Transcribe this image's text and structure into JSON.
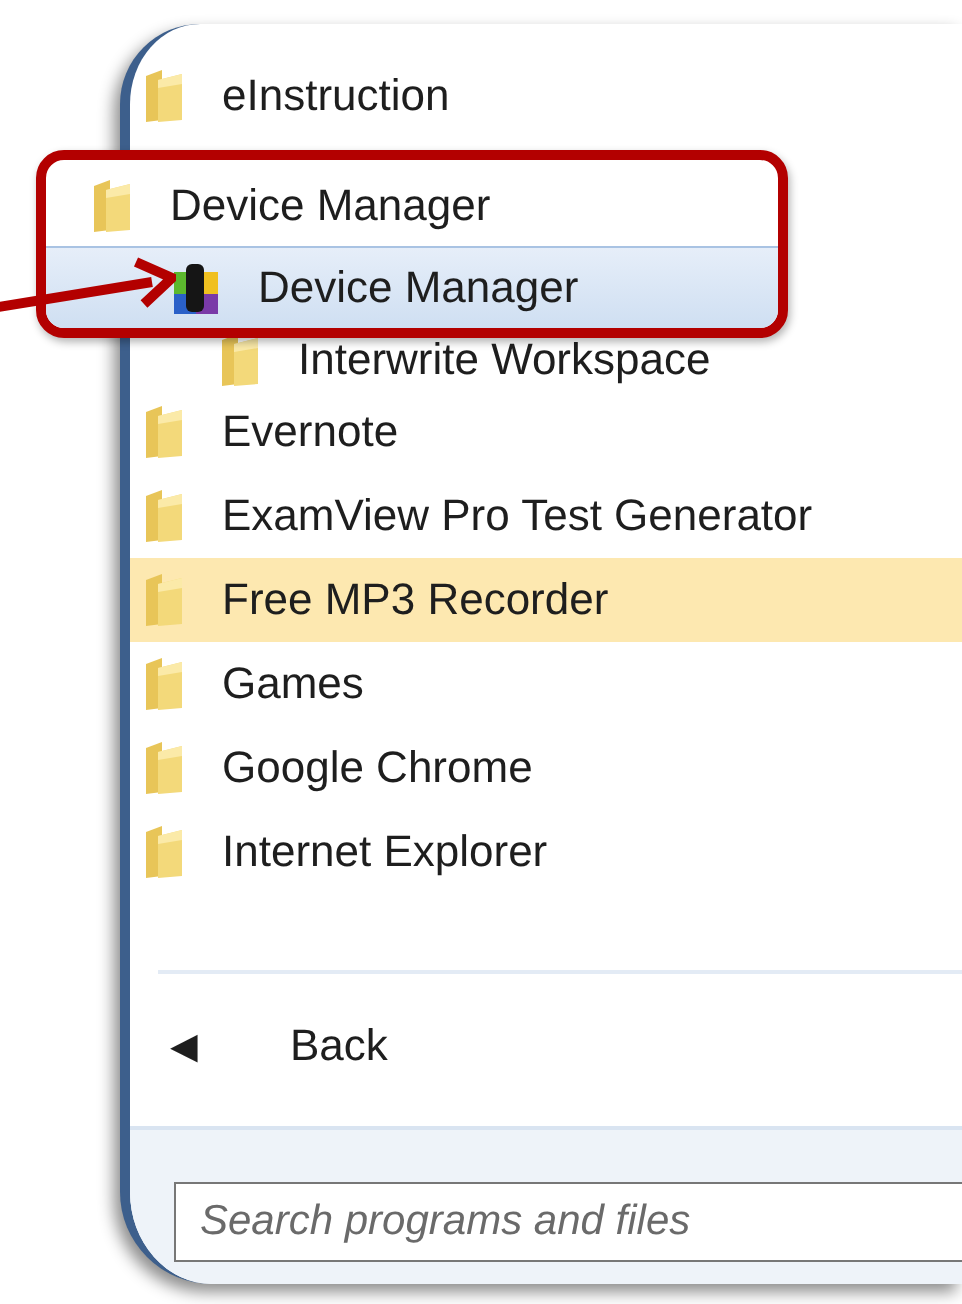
{
  "items": [
    {
      "label": "eInstruction",
      "kind": "folder",
      "selected": false,
      "children": [
        {
          "label": "Interwrite Workspace",
          "kind": "folder",
          "selected": false
        }
      ]
    },
    {
      "label": "Evernote",
      "kind": "folder",
      "selected": false
    },
    {
      "label": "ExamView Pro Test Generator",
      "kind": "folder",
      "selected": false
    },
    {
      "label": "Free MP3 Recorder",
      "kind": "folder",
      "selected": true
    },
    {
      "label": "Games",
      "kind": "folder",
      "selected": false
    },
    {
      "label": "Google Chrome",
      "kind": "folder",
      "selected": false
    },
    {
      "label": "Internet Explorer",
      "kind": "folder",
      "selected": false
    }
  ],
  "back": {
    "icon": "◀",
    "label": "Back"
  },
  "search": {
    "placeholder": "Search programs and files"
  },
  "callout": {
    "label": "Device Manager",
    "kind": "folder",
    "selected": false,
    "children": [
      {
        "label": "Device Manager",
        "kind": "app",
        "selected": true
      }
    ]
  }
}
